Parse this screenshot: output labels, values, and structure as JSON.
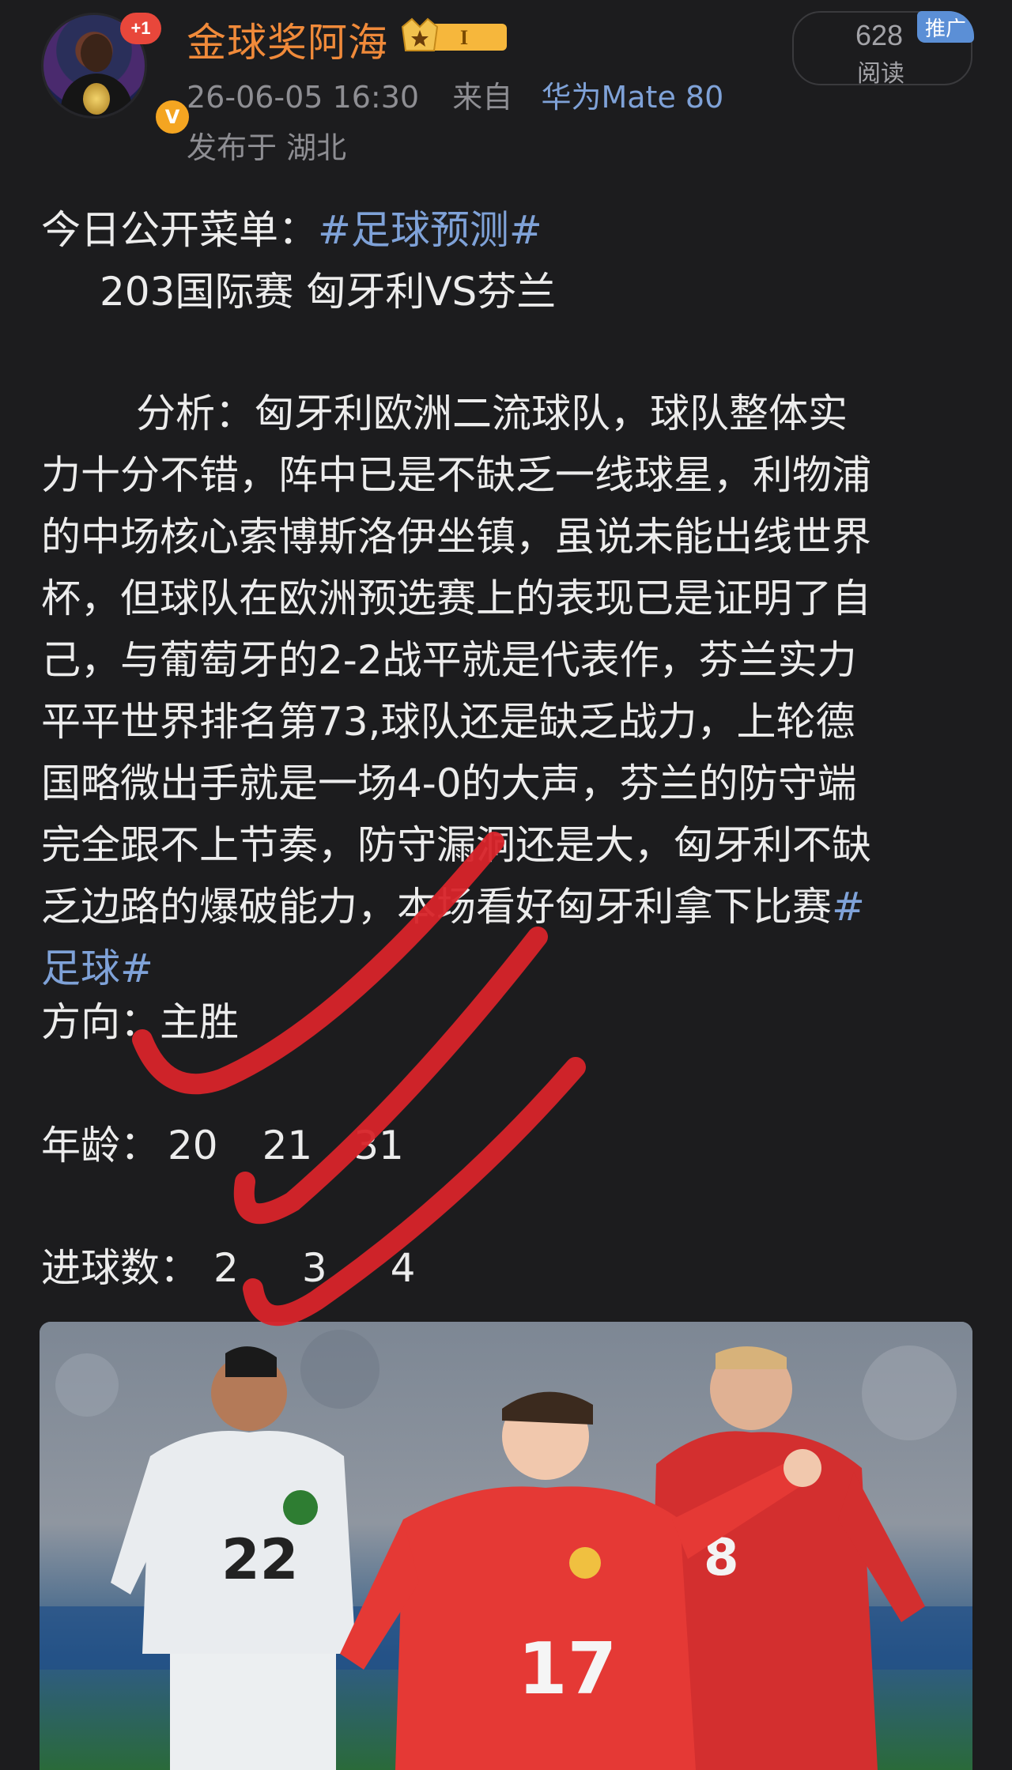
{
  "header": {
    "username": "金球奖阿海",
    "level_badge": "I",
    "avatar_notification": "+1",
    "verify_mark": "V",
    "post_time": "26-06-05 16:30",
    "from_label": "来自",
    "device": "华为Mate 80",
    "location": "发布于 湖北",
    "read_count": "628",
    "read_label": "阅读",
    "promo_tag": "推广"
  },
  "post": {
    "line1_prefix": "今日公开菜单：",
    "line1_hashtag": "#足球预测#",
    "line2": "203国际赛 匈牙利VS芬兰",
    "analysis_lines": [
      "分析：匈牙利欧洲二流球队，球队整体实",
      "力十分不错，阵中已是不缺乏一线球星，利物浦",
      "的中场核心索博斯洛伊坐镇，虽说未能出线世界",
      "杯，但球队在欧洲预选赛上的表现已是证明了自",
      "己，与葡萄牙的2-2战平就是代表作，芬兰实力",
      "平平世界排名第73,球队还是缺乏战力，上轮德",
      "国略微出手就是一场4-0的大声，芬兰的防守端",
      "完全跟不上节奏，防守漏洞还是大，匈牙利不缺",
      "乏边路的爆破能力，本场看好匈牙利拿下比赛"
    ],
    "analysis_hashtag_part1": "#",
    "analysis_hashtag_part2": "足球#",
    "direction_label": "方向：",
    "direction_value": "主胜",
    "age_label": "年龄：",
    "age_values": [
      "20",
      "21",
      "31"
    ],
    "goals_label": "进球数：",
    "goals_values": [
      "2",
      "3",
      "4"
    ]
  },
  "photo": {
    "jersey_numbers": [
      "22",
      "17",
      "8"
    ]
  },
  "colors": {
    "background": "#1c1c1e",
    "username": "#f08a3a",
    "link": "#7fa2d8",
    "check_mark": "#d8242a"
  }
}
